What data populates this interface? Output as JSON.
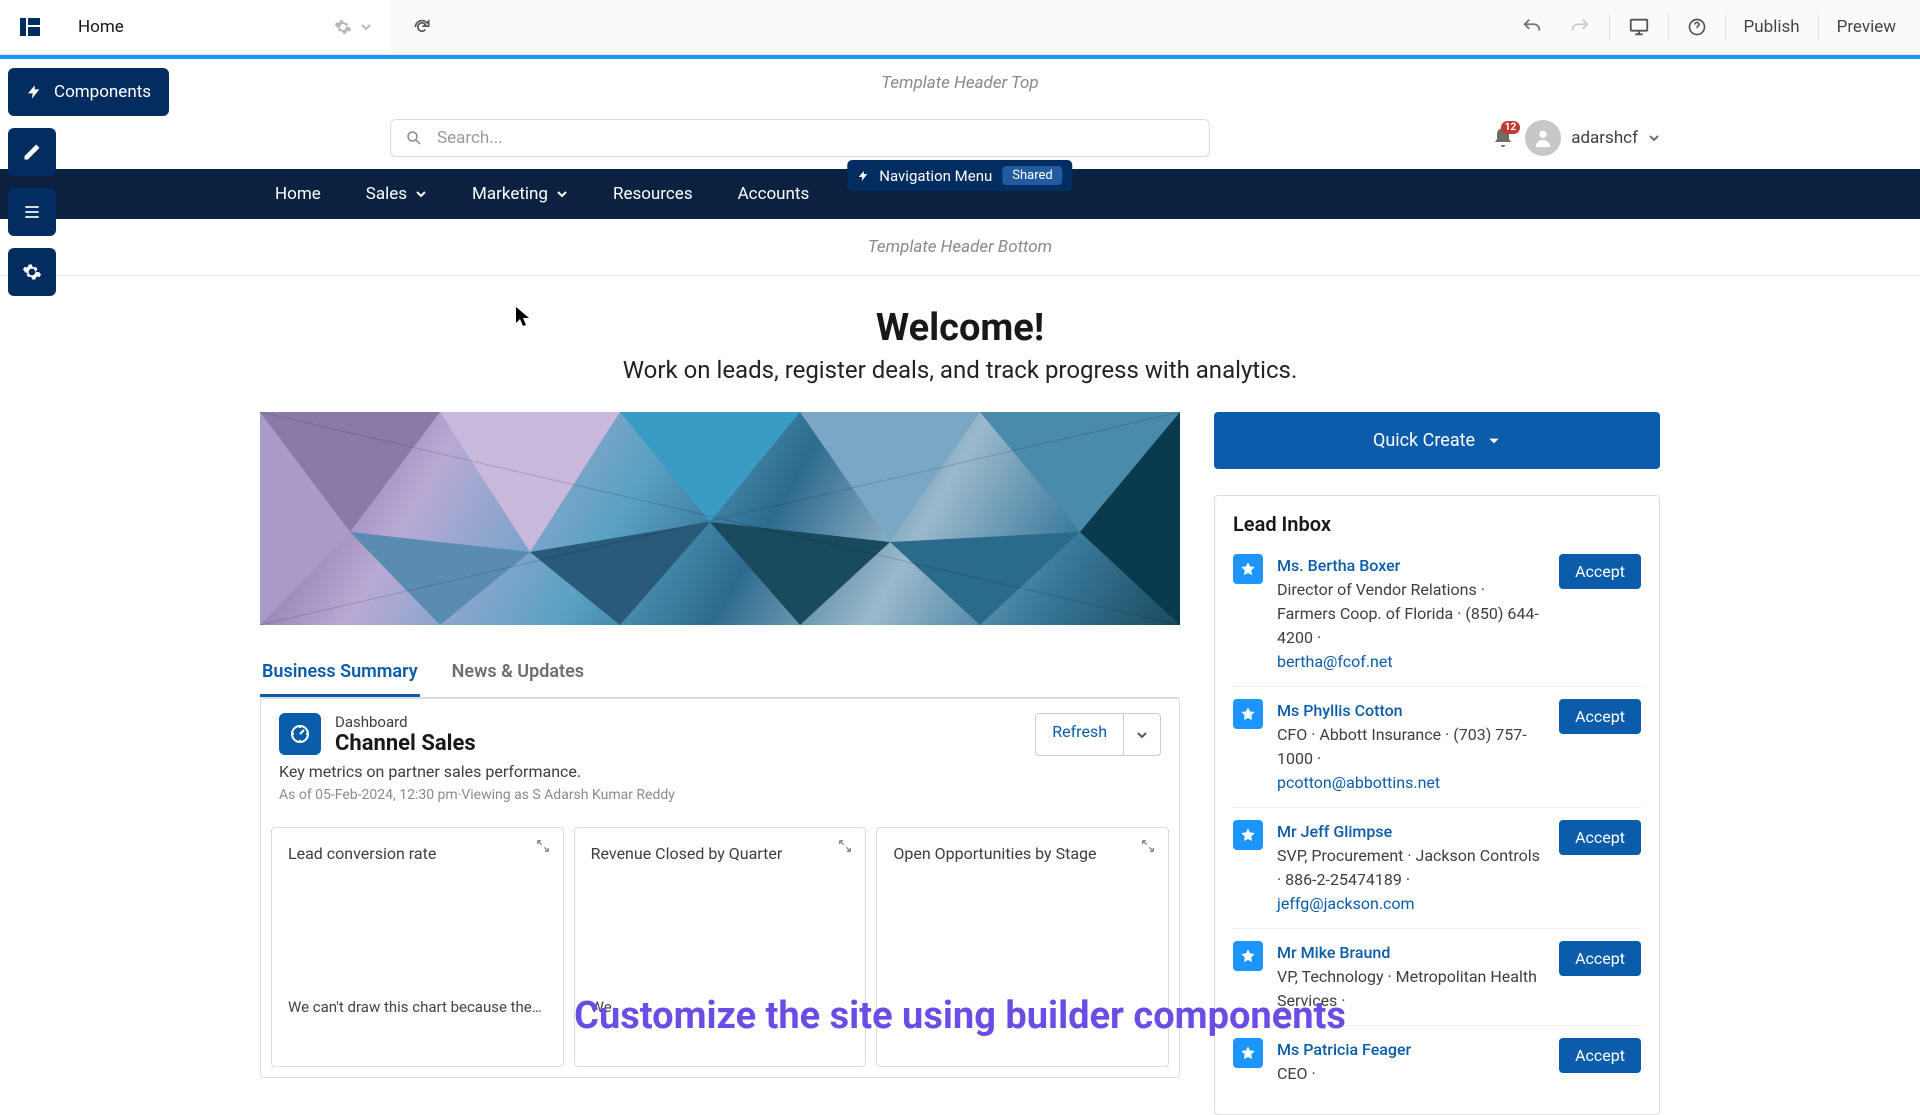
{
  "builder": {
    "page_label": "Home",
    "actions": {
      "publish": "Publish",
      "preview": "Preview"
    }
  },
  "sidebar": {
    "components_label": "Components"
  },
  "zones": {
    "header_top": "Template Header Top",
    "header_bottom": "Template Header Bottom"
  },
  "search": {
    "placeholder": "Search..."
  },
  "notifications": {
    "count": "12"
  },
  "user": {
    "name": "adarshcf"
  },
  "nav_floating": {
    "label": "Navigation Menu",
    "tag": "Shared"
  },
  "nav": {
    "items": [
      "Home",
      "Sales",
      "Marketing",
      "Resources",
      "Accounts"
    ]
  },
  "welcome": {
    "title": "Welcome!",
    "subtitle": "Work on leads, register deals, and track progress with analytics."
  },
  "tabs": {
    "a": "Business Summary",
    "b": "News & Updates"
  },
  "dashboard": {
    "kicker": "Dashboard",
    "title": "Channel Sales",
    "subtitle": "Key metrics on partner sales performance.",
    "meta": "As of 05-Feb-2024, 12:30 pm·Viewing as S Adarsh Kumar Reddy",
    "refresh": "Refresh",
    "widgets": {
      "a": {
        "title": "Lead conversion rate",
        "msg": "We can't draw this chart because there is no d..."
      },
      "b": {
        "title": "Revenue Closed by Quarter",
        "msg": "We"
      },
      "c": {
        "title": "Open Opportunities by Stage",
        "msg": ""
      }
    }
  },
  "right": {
    "quick_create": "Quick Create",
    "inbox_title": "Lead Inbox",
    "accept": "Accept",
    "leads": [
      {
        "name": "Ms. Bertha Boxer",
        "line": "Director of Vendor Relations · Farmers Coop. of Florida · (850) 644-4200 ·",
        "email": "bertha@fcof.net"
      },
      {
        "name": "Ms Phyllis Cotton",
        "line": "CFO · Abbott Insurance · (703) 757-1000 ·",
        "email": "pcotton@abbottins.net"
      },
      {
        "name": "Mr Jeff Glimpse",
        "line": "SVP, Procurement · Jackson Controls · 886-2-25474189 ·",
        "email": "jeffg@jackson.com"
      },
      {
        "name": "Mr Mike Braund",
        "line": "VP, Technology · Metropolitan Health Services ·",
        "email": ""
      },
      {
        "name": "Ms Patricia Feager",
        "line": "CEO ·",
        "email": ""
      }
    ]
  },
  "caption": "Customize the site using builder components"
}
